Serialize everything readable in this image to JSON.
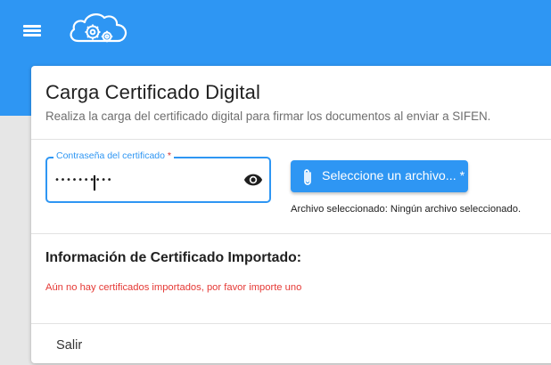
{
  "colors": {
    "primary": "#2e96f3",
    "error": "#e53935",
    "required": "#d32f2f"
  },
  "header": {
    "menu_icon": "hamburger-menu-icon",
    "logo_icon": "cloud-gears-logo-icon"
  },
  "card": {
    "title": "Carga Certificado Digital",
    "subtitle": "Realiza la carga del certificado digital para firmar los documentos al enviar a SIFEN."
  },
  "password_field": {
    "label": "Contraseña del certificado",
    "required_mark": "*",
    "value": "••••••••••",
    "toggle_icon": "eye-icon"
  },
  "file_upload": {
    "button_label": "Seleccione un archivo... *",
    "button_icon": "paperclip-icon",
    "status": "Archivo seleccionado: Ningún archivo seleccionado."
  },
  "imported_info": {
    "title": "Información de Certificado Importado:",
    "empty_message": "Aún no hay certificados importados, por favor importe uno"
  },
  "actions": {
    "exit_label": "Salir"
  }
}
